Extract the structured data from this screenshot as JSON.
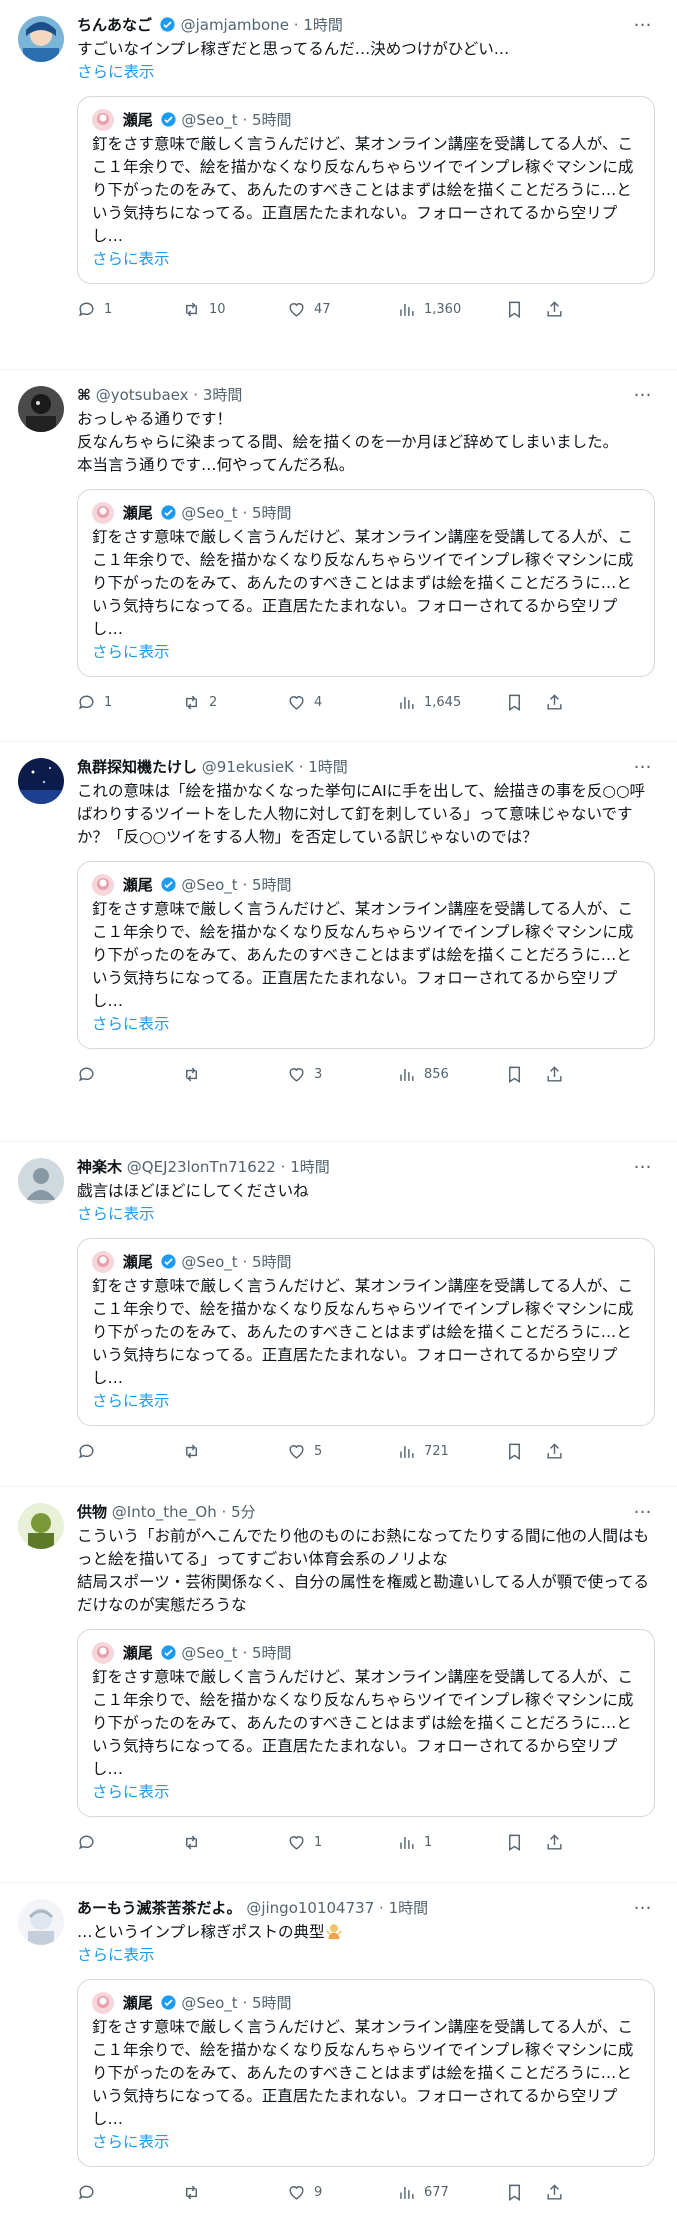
{
  "more_label": "…",
  "quoted": {
    "name": "瀬尾",
    "handle": "@Seo_t",
    "sep": "·",
    "time": "5時間",
    "text": "釘をさす意味で厳しく言うんだけど、某オンライン講座を受講してる人が、ここ１年余りで、絵を描かなくなり反なんちゃらツイでインプレ稼ぐマシンに成り下がったのをみて、あんたのすべきことはまずは絵を描くことだろうに…という気持ちになってる。正直居たたまれない。フォローされてるから空リプし…",
    "show_more": "さらに表示"
  },
  "posts": [
    {
      "name": "ちんあなご",
      "handle": "@jamjambone",
      "sep": "·",
      "time": "1時間",
      "text": "すごいなインプレ稼ぎだと思ってるんだ…決めつけがひどい…",
      "show_more": "さらに表示",
      "replies": "1",
      "reposts": "10",
      "likes": "47",
      "views": "1,360"
    },
    {
      "name": "⌘",
      "handle": "@yotsubaex",
      "sep": "·",
      "time": "3時間",
      "text": "おっしゃる通りです！\n反なんちゃらに染まってる間、絵を描くのを一か月ほど辞めてしまいました。\n本当言う通りです…何やってんだろ私。",
      "show_more": "",
      "replies": "1",
      "reposts": "2",
      "likes": "4",
      "views": "1,645"
    },
    {
      "name": "魚群探知機たけし",
      "handle": "@91ekusieK",
      "sep": "·",
      "time": "1時間",
      "text": "これの意味は「絵を描かなくなった挙句にAIに手を出して、絵描きの事を反○○呼ばわりするツイートをした人物に対して釘を刺している」って意味じゃないですか？「反○○ツイをする人物」を否定している訳じゃないのでは？",
      "show_more": "",
      "replies": "",
      "reposts": "",
      "likes": "3",
      "views": "856"
    },
    {
      "name": "神楽木",
      "handle": "@QEJ23lonTn71622",
      "sep": "·",
      "time": "1時間",
      "text": "戯言はほどほどにしてくださいね",
      "show_more": "さらに表示",
      "replies": "",
      "reposts": "",
      "likes": "5",
      "views": "721"
    },
    {
      "name": "供物",
      "handle": "@Into_the_Oh",
      "sep": "·",
      "time": "5分",
      "text": "こういう「お前がへこんでたり他のものにお熱になってたりする間に他の人間はもっと絵を描いてる」ってすごおい体育会系のノリよな\n結局スポーツ・芸術関係なく、自分の属性を権威と勘違いしてる人が顎で使ってるだけなのが実態だろうな",
      "show_more": "",
      "replies": "",
      "reposts": "",
      "likes": "1",
      "views": "1"
    },
    {
      "name": "あーもう滅茶苦茶だよ。",
      "handle": "@jingo10104737",
      "sep": "·",
      "time": "1時間",
      "text": "…というインプレ稼ぎポストの典型",
      "show_more": "さらに表示",
      "replies": "",
      "reposts": "",
      "likes": "9",
      "views": "677"
    }
  ],
  "colors": {
    "accent": "#1d9bf0",
    "muted": "#536471",
    "border": "#cfd9de",
    "text": "#0f1419"
  }
}
